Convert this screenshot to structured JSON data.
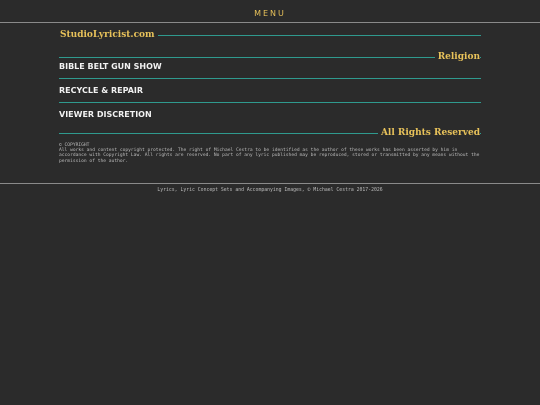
{
  "nav": {
    "menu_label": "MENU"
  },
  "header": {
    "site_title": "StudioLyricist.com"
  },
  "sections": {
    "religion_label": "Religion",
    "rights_label": "All Rights Reserved"
  },
  "songs": [
    {
      "title": "BIBLE BELT GUN SHOW"
    },
    {
      "title": "RECYCLE & REPAIR"
    },
    {
      "title": "VIEWER DISCRETION"
    }
  ],
  "copyright": {
    "heading": "© COPYRIGHT",
    "body": "All works and content copyright protected. The right of Michael Cestra to be identified as the author of these works has been asserted by him in accordance with Copyright Law. All rights are reserved. No part of any lyric published may be reproduced, stored or transmitted by any means without the permission of the author."
  },
  "footer": {
    "text": "Lyrics, Lyric Concept Sets and Accompanying Images, © Michael Cestra 2017-2026"
  },
  "colors": {
    "background": "#2b2b2b",
    "accent": "#e8c25a",
    "divider": "#2f9a8e"
  }
}
